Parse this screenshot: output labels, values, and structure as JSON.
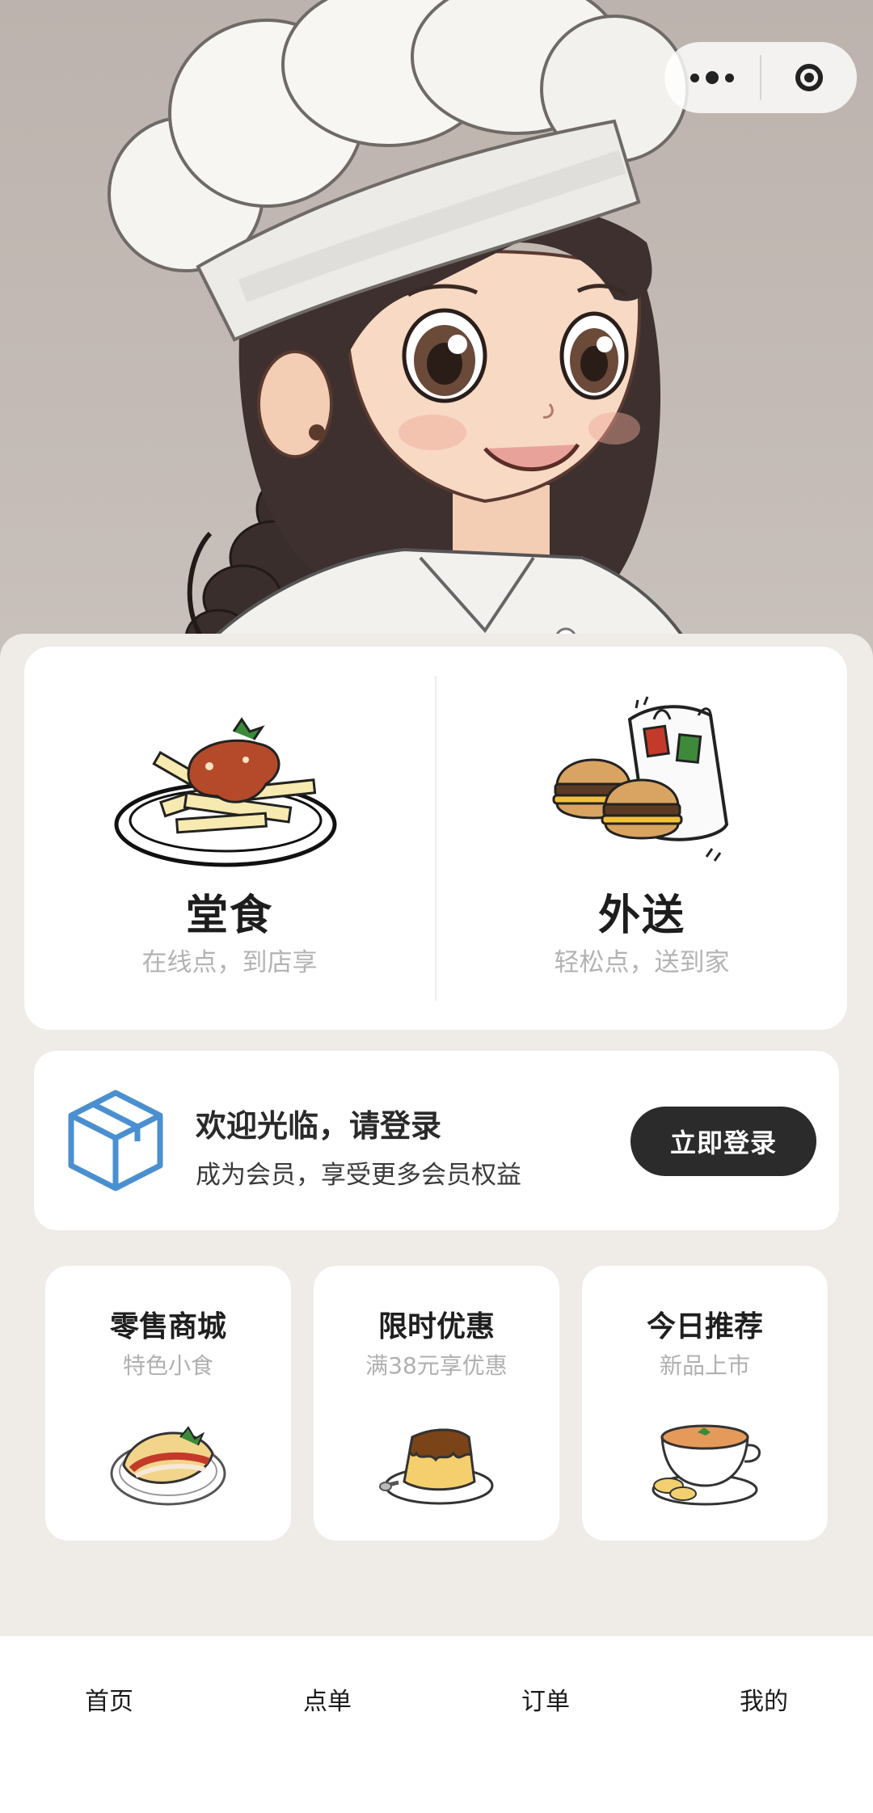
{
  "capsule": {
    "more_icon": "more-dots-icon",
    "close_icon": "target-circle-icon"
  },
  "services": [
    {
      "title": "堂食",
      "subtitle": "在线点，到店享",
      "icon": "plate-food-icon"
    },
    {
      "title": "外送",
      "subtitle": "轻松点，送到家",
      "icon": "burger-bag-icon"
    }
  ],
  "login": {
    "title": "欢迎光临，请登录",
    "description": "成为会员，享受更多会员权益",
    "button": "立即登录",
    "icon": "box-icon"
  },
  "promos": [
    {
      "title": "零售商城",
      "subtitle": "特色小食",
      "icon": "taco-icon"
    },
    {
      "title": "限时优惠",
      "subtitle": "满38元享优惠",
      "icon": "pudding-icon"
    },
    {
      "title": "今日推荐",
      "subtitle": "新品上市",
      "icon": "soup-icon"
    }
  ],
  "tabbar": [
    {
      "label": "首页"
    },
    {
      "label": "点单"
    },
    {
      "label": "订单"
    },
    {
      "label": "我的"
    }
  ],
  "colors": {
    "background": "#efebe6",
    "card": "#ffffff",
    "button": "#2b2b2b",
    "muted_text": "#b3b3b3",
    "box_icon_blue": "#4a90d0"
  }
}
